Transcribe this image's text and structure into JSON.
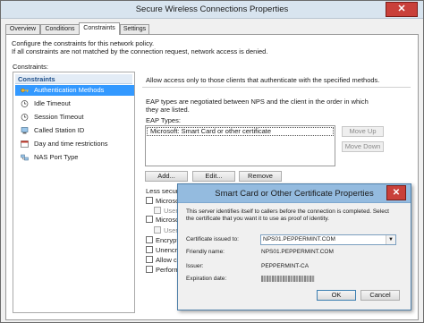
{
  "window": {
    "title": "Secure Wireless Connections Properties",
    "close_glyph": "✕"
  },
  "tabs": [
    {
      "label": "Overview"
    },
    {
      "label": "Conditions"
    },
    {
      "label": "Constraints"
    },
    {
      "label": "Settings"
    }
  ],
  "description": {
    "line1": "Configure the constraints for this network policy.",
    "line2": "If all constraints are not matched by the connection request, network access is denied."
  },
  "constraints": {
    "label": "Constraints:",
    "header": "Constraints",
    "items": [
      {
        "label": "Authentication Methods",
        "icon": "key-icon"
      },
      {
        "label": "Idle Timeout",
        "icon": "clock-icon"
      },
      {
        "label": "Session Timeout",
        "icon": "clock-icon"
      },
      {
        "label": "Called Station ID",
        "icon": "computer-icon"
      },
      {
        "label": "Day and time restrictions",
        "icon": "calendar-icon"
      },
      {
        "label": "NAS Port Type",
        "icon": "network-icon"
      }
    ]
  },
  "auth": {
    "allow_text": "Allow access only to those clients that authenticate with the specified methods.",
    "eap_desc1": "EAP types are negotiated between NPS and the client in the order in which",
    "eap_desc2": "they are listed.",
    "eap_types_label": "EAP Types:",
    "eap_items": [
      "Microsoft: Smart Card or other certificate"
    ],
    "move_up": "Move Up",
    "move_down": "Move Down",
    "add": "Add...",
    "edit": "Edit...",
    "remove": "Remove",
    "less_secure": "Less secur",
    "methods": [
      {
        "label": "Microso"
      },
      {
        "label": "User"
      },
      {
        "label": "Microso"
      },
      {
        "label": "User"
      },
      {
        "label": "Encrypti"
      },
      {
        "label": "Unencry"
      },
      {
        "label": "Allow cl"
      },
      {
        "label": "Perform"
      }
    ]
  },
  "dialog": {
    "title": "Smart Card or Other Certificate Properties",
    "close_glyph": "✕",
    "desc1": "This server identifies itself to callers before the connection is completed. Select",
    "desc2": "the certificate that you want it to use as proof of identity.",
    "cert_issued_label": "Certificate issued to:",
    "cert_issued_value": "NPS01.PEPPERMINT.COM",
    "friendly_label": "Friendly name:",
    "friendly_value": "NPS01.PEPPERMINT.COM",
    "issuer_label": "Issuer:",
    "issuer_value": "PEPPERMINT-CA",
    "expiration_label": "Expiration date:",
    "ok": "OK",
    "cancel": "Cancel"
  }
}
